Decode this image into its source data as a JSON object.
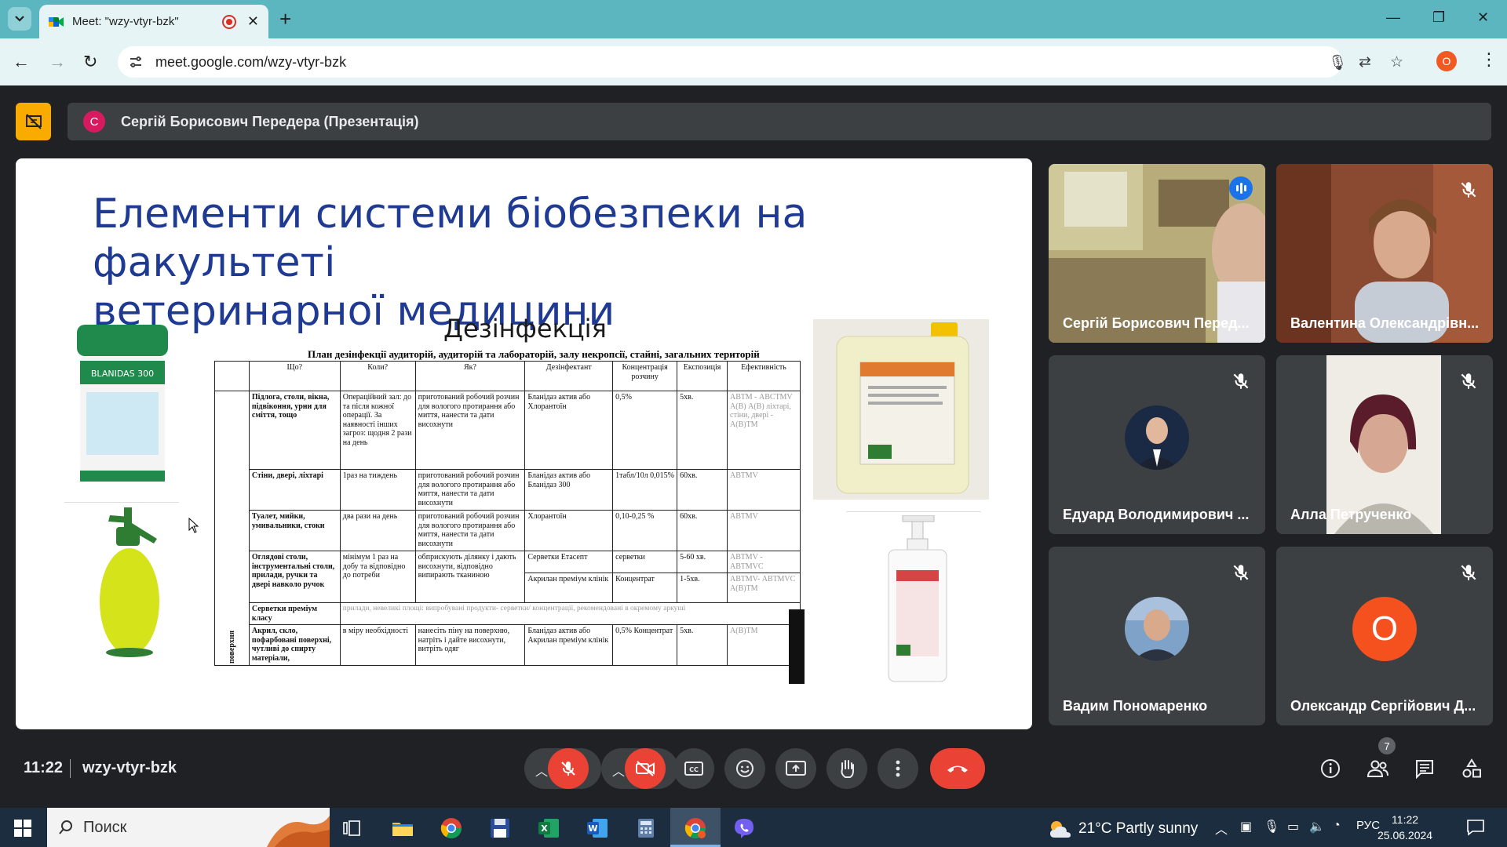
{
  "browser": {
    "tab_title": "Meet: \"wzy-vtyr-bzk\"",
    "new_tab": "+",
    "url": "meet.google.com/wzy-vtyr-bzk",
    "profile_initial": "O",
    "window": {
      "minimize": "—",
      "restore": "❐",
      "close": "✕"
    }
  },
  "meet": {
    "presenter_initial": "С",
    "presenter_label": "Сергій Борисович Передера (Презентація)",
    "time": "11:22",
    "meeting_code": "wzy-vtyr-bzk",
    "participants_count": "7"
  },
  "slide": {
    "title_line1": "Елементи системи біобезпеки на факультеті",
    "title_line2": "ветеринарної медицини",
    "subtitle": "Дезінфекція",
    "table_caption": "План дезінфекції аудиторій, аудиторій та лабораторій, залу некропсії, стайні, загальних територій",
    "jar_label": "BLANIDAS 300",
    "vertical_label": "поверхня",
    "headers": [
      "Що?",
      "Коли?",
      "Як?",
      "Дезінфектант",
      "Концентрація розчину",
      "Експозиція",
      "Ефективність"
    ],
    "rows": [
      {
        "what": "Підлога, столи, вікна, підвіконня, урни для сміття, тощо",
        "when": "Операційний зал: до та після кожної операції. За наявності інших загроз: щодня 2 рази на день",
        "how": "приготований робочий розчин для вологого протирання або миття, нанести та дати висохнути",
        "agent": "Бланідаз актив або Хлорантоїн",
        "conc": "0,5%",
        "exp": "5хв.",
        "eff": "АВТМ - АВСТМV А(В) А(В) ліхтарі, стіни, двері - А(В)ТМ"
      },
      {
        "what": "Стіни, двері, ліхтарі",
        "when": "1раз на тиждень",
        "how": "приготований робочий розчин для вологого протирання або миття, нанести та дати висохнути",
        "agent": "Бланідаз актив або Бланідаз 300",
        "conc": "1табл/10л 0,015%",
        "exp": "60хв.",
        "eff": "АВТМV"
      },
      {
        "what": "Туалет, мийки, умивальники, стоки",
        "when": "два рази на день",
        "how": "приготований робочий розчин для вологого протирання або миття, нанести та дати висохнути",
        "agent": "Хлорантоїн",
        "conc": "0,10-0,25 %",
        "exp": "60хв.",
        "eff": "АВТМV"
      },
      {
        "what": "Оглядові столи, інструментальні столи, прилади, ручки та двері навколо ручок",
        "when": "мінімум 1 раз на добу та відповідно до потреби",
        "how": "обприскують ділянку і дають висохнути, відповідно випирають тканиною",
        "agent": "Серветки Етасепт",
        "conc": "серветки",
        "exp": "5-60 хв.",
        "eff": "АВТМV - АВТМVС",
        "agent2": "Акрилан преміум клінік",
        "conc2": "Концентрат",
        "exp2": "1-5хв.",
        "eff2": "АВТМV- АВТМVС А(В)ТМ"
      },
      {
        "what": "Серветки преміум класу",
        "note": "прилади, невеликі площі: випробувані продукти- серветки/ концентрації, рекомендовані в окремому аркуші"
      },
      {
        "what": "Акрил, скло, пофарбовані поверхні, чутливі до спирту матеріали,",
        "when": "в міру необхідності",
        "how": "нанесіть піну на поверхню, натріть і дайте висохнути, витріть одяг",
        "agent": "Бланідаз актив або Акрилан преміум клінік",
        "conc": "0,5% Концентрат",
        "exp": "5хв.",
        "eff": "А(В)ТМ"
      }
    ]
  },
  "participants": [
    {
      "name": "Сергій Борисович Перед...",
      "speaking": true
    },
    {
      "name": "Валентина Олександрівн...",
      "muted": true
    },
    {
      "name": "Едуард Володимирович ...",
      "muted": true
    },
    {
      "name": "Алла Петрученко",
      "muted": true
    },
    {
      "name": "Вадим Пономаренко",
      "muted": true
    },
    {
      "name": "Олександр Сергійович Д...",
      "muted": true,
      "initial": "О",
      "color": "#f4511e"
    }
  ],
  "taskbar": {
    "search_placeholder": "Поиск",
    "weather": "21°C  Partly sunny",
    "language": "РУС",
    "time": "11:22",
    "date": "25.06.2024"
  }
}
